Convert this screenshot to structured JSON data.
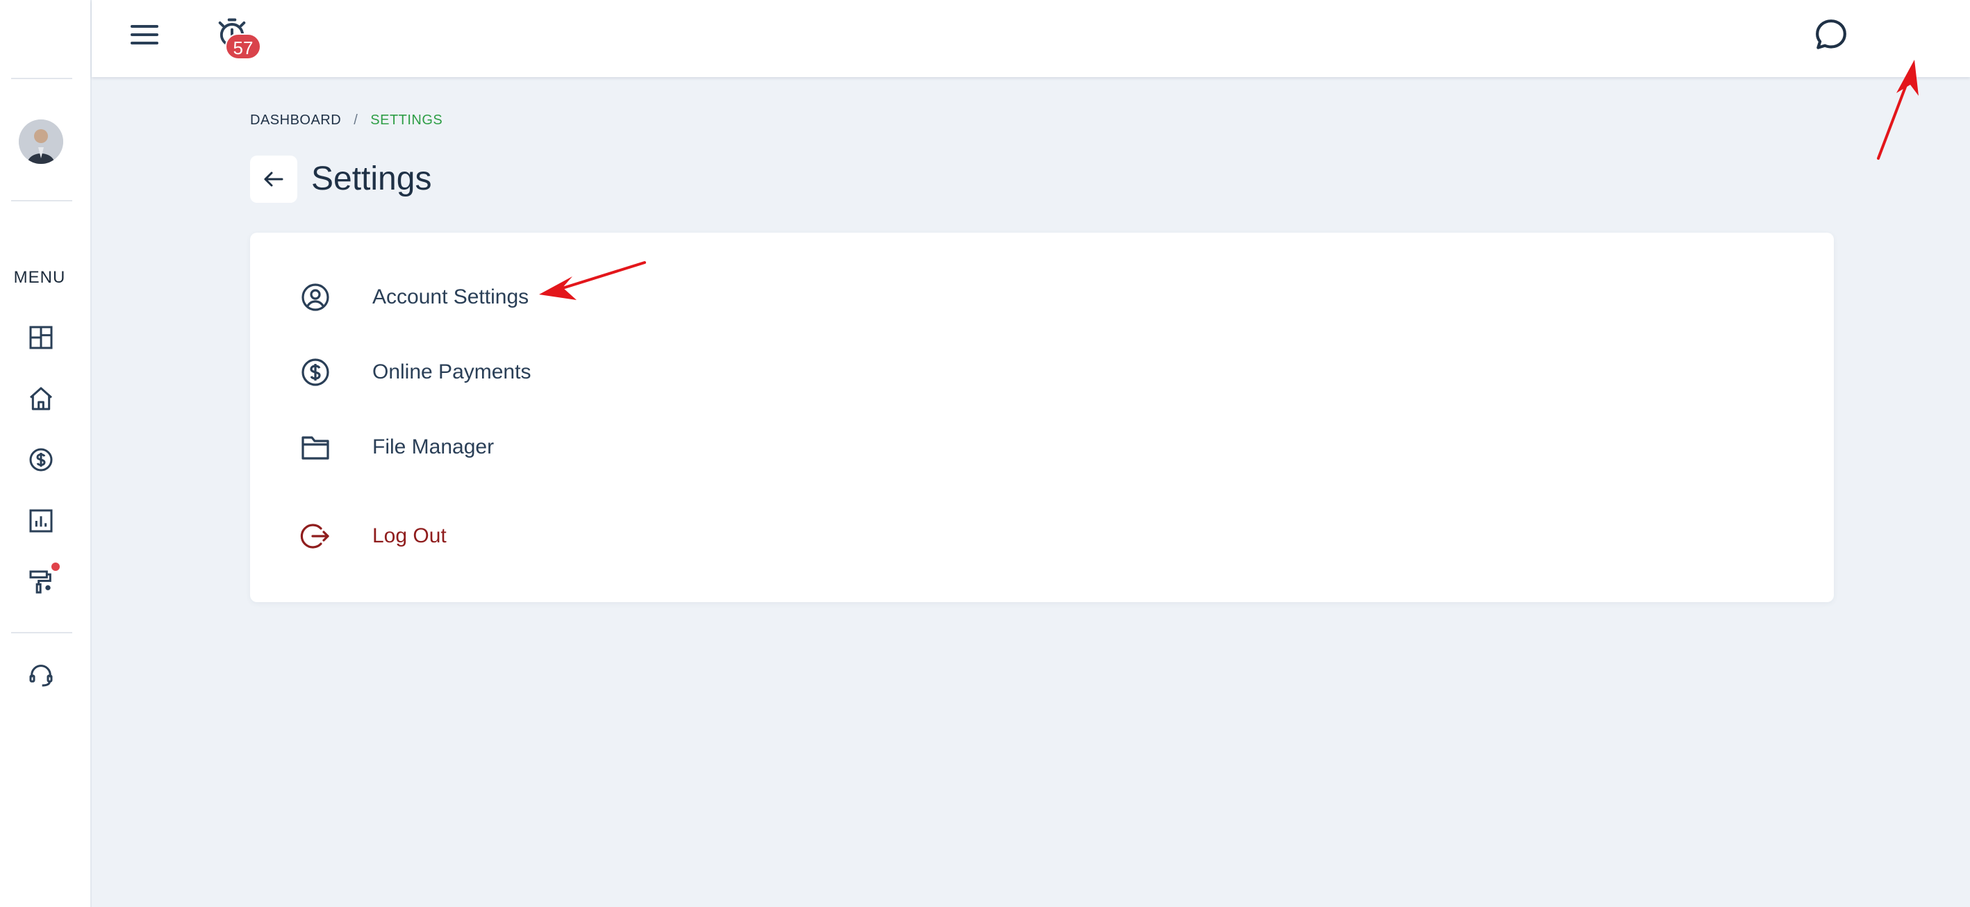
{
  "sidebar": {
    "menu_label": "MENU",
    "items": [
      {
        "icon": "dashboard-icon"
      },
      {
        "icon": "home-icon"
      },
      {
        "icon": "dollar-icon"
      },
      {
        "icon": "report-icon"
      },
      {
        "icon": "paint-roller-icon",
        "has_notification_dot": true
      },
      {
        "icon": "support-headset-icon"
      }
    ]
  },
  "topbar": {
    "timer_badge": "57",
    "accent_color": "#2e9e46",
    "badge_color": "#d9434b"
  },
  "breadcrumb": {
    "items": [
      "DASHBOARD",
      "SETTINGS"
    ],
    "separator": "/"
  },
  "page": {
    "title": "Settings"
  },
  "settings_menu": {
    "items": [
      {
        "label": "Account Settings",
        "icon": "user-circle-icon"
      },
      {
        "label": "Online Payments",
        "icon": "dollar-circle-icon"
      },
      {
        "label": "File Manager",
        "icon": "folder-icon"
      },
      {
        "label": "Log Out",
        "icon": "logout-icon",
        "color": "#8f1d1d"
      }
    ]
  }
}
